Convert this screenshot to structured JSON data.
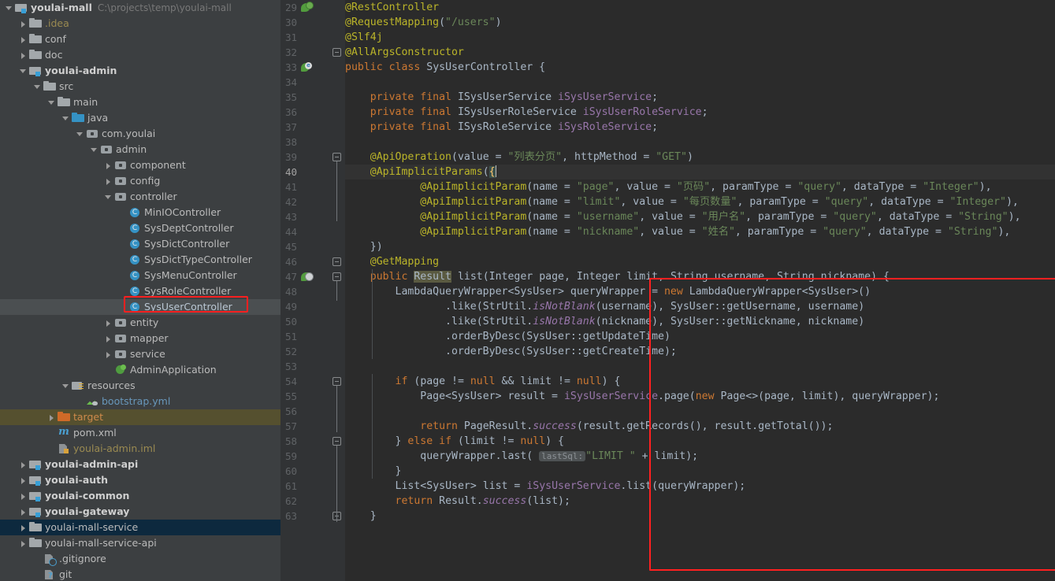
{
  "project": {
    "name": "youlai-mall",
    "path": "C:\\projects\\temp\\youlai-mall"
  },
  "colors": {
    "accent_highlight": "#ff2020",
    "selection_blue": "#0d293e",
    "target_folder": "#55502f",
    "editor_bg": "#2b2b2b",
    "gutter_bg": "#313335",
    "panel_bg": "#3c3f41"
  },
  "tree": {
    "items": [
      {
        "label": "youlai-mall",
        "suffix": "C:\\projects\\temp\\youlai-mall",
        "depth": 0,
        "arrow": "expanded",
        "icon": "module-folder-icon",
        "bold": true,
        "state": "none"
      },
      {
        "label": ".idea",
        "depth": 1,
        "arrow": "collapsed",
        "icon": "folder-icon",
        "bold": false,
        "state": "none",
        "tint": "yellow"
      },
      {
        "label": "conf",
        "depth": 1,
        "arrow": "collapsed",
        "icon": "folder-icon",
        "bold": false,
        "state": "none"
      },
      {
        "label": "doc",
        "depth": 1,
        "arrow": "collapsed",
        "icon": "folder-icon",
        "bold": false,
        "state": "none"
      },
      {
        "label": "youlai-admin",
        "depth": 1,
        "arrow": "expanded",
        "icon": "module-folder-icon",
        "bold": true,
        "state": "none"
      },
      {
        "label": "src",
        "depth": 2,
        "arrow": "expanded",
        "icon": "folder-icon",
        "bold": false,
        "state": "none"
      },
      {
        "label": "main",
        "depth": 3,
        "arrow": "expanded",
        "icon": "folder-icon",
        "bold": false,
        "state": "none"
      },
      {
        "label": "java",
        "depth": 4,
        "arrow": "expanded",
        "icon": "source-root-icon",
        "bold": false,
        "state": "none"
      },
      {
        "label": "com.youlai",
        "depth": 5,
        "arrow": "expanded",
        "icon": "package-icon",
        "bold": false,
        "state": "none"
      },
      {
        "label": "admin",
        "depth": 6,
        "arrow": "expanded",
        "icon": "package-icon",
        "bold": false,
        "state": "none"
      },
      {
        "label": "component",
        "depth": 7,
        "arrow": "collapsed",
        "icon": "package-icon",
        "bold": false,
        "state": "none"
      },
      {
        "label": "config",
        "depth": 7,
        "arrow": "collapsed",
        "icon": "package-icon",
        "bold": false,
        "state": "none"
      },
      {
        "label": "controller",
        "depth": 7,
        "arrow": "expanded",
        "icon": "package-icon",
        "bold": false,
        "state": "none"
      },
      {
        "label": "MinIOController",
        "depth": 8,
        "arrow": "none",
        "icon": "java-class-icon",
        "bold": false,
        "state": "none"
      },
      {
        "label": "SysDeptController",
        "depth": 8,
        "arrow": "none",
        "icon": "java-class-icon",
        "bold": false,
        "state": "none"
      },
      {
        "label": "SysDictController",
        "depth": 8,
        "arrow": "none",
        "icon": "java-class-icon",
        "bold": false,
        "state": "none"
      },
      {
        "label": "SysDictTypeController",
        "depth": 8,
        "arrow": "none",
        "icon": "java-class-icon",
        "bold": false,
        "state": "none"
      },
      {
        "label": "SysMenuController",
        "depth": 8,
        "arrow": "none",
        "icon": "java-class-icon",
        "bold": false,
        "state": "none"
      },
      {
        "label": "SysRoleController",
        "depth": 8,
        "arrow": "none",
        "icon": "java-class-icon",
        "bold": false,
        "state": "none"
      },
      {
        "label": "SysUserController",
        "depth": 8,
        "arrow": "none",
        "icon": "java-class-icon",
        "bold": false,
        "state": "hover"
      },
      {
        "label": "entity",
        "depth": 7,
        "arrow": "collapsed",
        "icon": "package-icon",
        "bold": false,
        "state": "none"
      },
      {
        "label": "mapper",
        "depth": 7,
        "arrow": "collapsed",
        "icon": "package-icon",
        "bold": false,
        "state": "none"
      },
      {
        "label": "service",
        "depth": 7,
        "arrow": "collapsed",
        "icon": "package-icon",
        "bold": false,
        "state": "none"
      },
      {
        "label": "AdminApplication",
        "depth": 7,
        "arrow": "none",
        "icon": "spring-boot-icon",
        "bold": false,
        "state": "none"
      },
      {
        "label": "resources",
        "depth": 4,
        "arrow": "expanded",
        "icon": "resources-folder-icon",
        "bold": false,
        "state": "none"
      },
      {
        "label": "bootstrap.yml",
        "depth": 5,
        "arrow": "none",
        "icon": "yaml-file-icon",
        "bold": false,
        "state": "none",
        "tint": "blue"
      },
      {
        "label": "target",
        "depth": 3,
        "arrow": "collapsed",
        "icon": "target-folder-icon",
        "bold": false,
        "state": "target",
        "tint": "orange"
      },
      {
        "label": "pom.xml",
        "depth": 3,
        "arrow": "none",
        "icon": "maven-file-icon",
        "bold": false,
        "state": "none"
      },
      {
        "label": "youlai-admin.iml",
        "depth": 3,
        "arrow": "none",
        "icon": "iml-file-icon",
        "bold": false,
        "state": "none",
        "tint": "yellow"
      },
      {
        "label": "youlai-admin-api",
        "depth": 1,
        "arrow": "collapsed",
        "icon": "module-folder-icon",
        "bold": true,
        "state": "none"
      },
      {
        "label": "youlai-auth",
        "depth": 1,
        "arrow": "collapsed",
        "icon": "module-folder-icon",
        "bold": true,
        "state": "none"
      },
      {
        "label": "youlai-common",
        "depth": 1,
        "arrow": "collapsed",
        "icon": "module-folder-icon",
        "bold": true,
        "state": "none"
      },
      {
        "label": "youlai-gateway",
        "depth": 1,
        "arrow": "collapsed",
        "icon": "module-folder-icon",
        "bold": true,
        "state": "none"
      },
      {
        "label": "youlai-mall-service",
        "depth": 1,
        "arrow": "collapsed",
        "icon": "folder-icon",
        "bold": false,
        "state": "selected"
      },
      {
        "label": "youlai-mall-service-api",
        "depth": 1,
        "arrow": "collapsed",
        "icon": "folder-icon",
        "bold": false,
        "state": "none"
      },
      {
        "label": ".gitignore",
        "depth": 2,
        "arrow": "none",
        "icon": "gitignore-file-icon",
        "bold": false,
        "state": "none"
      },
      {
        "label": "git",
        "depth": 2,
        "arrow": "none",
        "icon": "git-unknown-file-icon",
        "bold": false,
        "state": "none"
      }
    ]
  },
  "editor": {
    "file": "SysUserController.java",
    "first_line": 29,
    "caret_line": 40,
    "highlighted_identifier": "Result",
    "inlay_hint": "lastSql:",
    "lines": [
      {
        "n": 29,
        "gutter": "spring-bean-icon",
        "fold": null,
        "text": "@RestController"
      },
      {
        "n": 30,
        "gutter": null,
        "fold": null,
        "text": "@RequestMapping(\"/users\")"
      },
      {
        "n": 31,
        "gutter": null,
        "fold": null,
        "text": "@Slf4j"
      },
      {
        "n": 32,
        "gutter": null,
        "fold": "collapse",
        "text": "@AllArgsConstructor"
      },
      {
        "n": 33,
        "gutter": "spring-bean-e-icon",
        "fold": null,
        "text": "public class SysUserController {"
      },
      {
        "n": 34,
        "gutter": null,
        "fold": null,
        "text": ""
      },
      {
        "n": 35,
        "gutter": null,
        "fold": null,
        "text": "    private final ISysUserService iSysUserService;"
      },
      {
        "n": 36,
        "gutter": null,
        "fold": null,
        "text": "    private final ISysUserRoleService iSysUserRoleService;"
      },
      {
        "n": 37,
        "gutter": null,
        "fold": null,
        "text": "    private final ISysRoleService iSysRoleService;"
      },
      {
        "n": 38,
        "gutter": null,
        "fold": null,
        "text": ""
      },
      {
        "n": 39,
        "gutter": null,
        "fold": "collapse",
        "text": "    @ApiOperation(value = \"列表分页\", httpMethod = \"GET\")"
      },
      {
        "n": 40,
        "gutter": null,
        "fold": null,
        "text": "    @ApiImplicitParams({"
      },
      {
        "n": 41,
        "gutter": null,
        "fold": null,
        "text": "            @ApiImplicitParam(name = \"page\", value = \"页码\", paramType = \"query\", dataType = \"Integer\"),"
      },
      {
        "n": 42,
        "gutter": null,
        "fold": null,
        "text": "            @ApiImplicitParam(name = \"limit\", value = \"每页数量\", paramType = \"query\", dataType = \"Integer\"),"
      },
      {
        "n": 43,
        "gutter": null,
        "fold": null,
        "text": "            @ApiImplicitParam(name = \"username\", value = \"用户名\", paramType = \"query\", dataType = \"String\"),"
      },
      {
        "n": 44,
        "gutter": null,
        "fold": null,
        "text": "            @ApiImplicitParam(name = \"nickname\", value = \"姓名\", paramType = \"query\", dataType = \"String\"),"
      },
      {
        "n": 45,
        "gutter": null,
        "fold": null,
        "text": "    })"
      },
      {
        "n": 46,
        "gutter": null,
        "fold": "collapse",
        "text": "    @GetMapping"
      },
      {
        "n": 47,
        "gutter": "web-mapping-icon",
        "fold": "collapse",
        "text": "    public Result list(Integer page, Integer limit, String username, String nickname) {"
      },
      {
        "n": 48,
        "gutter": null,
        "fold": null,
        "text": "        LambdaQueryWrapper<SysUser> queryWrapper = new LambdaQueryWrapper<SysUser>()"
      },
      {
        "n": 49,
        "gutter": null,
        "fold": null,
        "text": "                .like(StrUtil.isNotBlank(username), SysUser::getUsername, username)"
      },
      {
        "n": 50,
        "gutter": null,
        "fold": null,
        "text": "                .like(StrUtil.isNotBlank(nickname), SysUser::getNickname, nickname)"
      },
      {
        "n": 51,
        "gutter": null,
        "fold": null,
        "text": "                .orderByDesc(SysUser::getUpdateTime)"
      },
      {
        "n": 52,
        "gutter": null,
        "fold": null,
        "text": "                .orderByDesc(SysUser::getCreateTime);"
      },
      {
        "n": 53,
        "gutter": null,
        "fold": null,
        "text": ""
      },
      {
        "n": 54,
        "gutter": null,
        "fold": "collapse",
        "text": "        if (page != null && limit != null) {"
      },
      {
        "n": 55,
        "gutter": null,
        "fold": null,
        "text": "            Page<SysUser> result = iSysUserService.page(new Page<>(page, limit), queryWrapper);"
      },
      {
        "n": 56,
        "gutter": null,
        "fold": null,
        "text": ""
      },
      {
        "n": 57,
        "gutter": null,
        "fold": null,
        "text": "            return PageResult.success(result.getRecords(), result.getTotal());"
      },
      {
        "n": 58,
        "gutter": null,
        "fold": "collapse",
        "text": "        } else if (limit != null) {"
      },
      {
        "n": 59,
        "gutter": null,
        "fold": null,
        "text": "            queryWrapper.last( lastSql: \"LIMIT \" + limit);"
      },
      {
        "n": 60,
        "gutter": null,
        "fold": null,
        "text": "        }"
      },
      {
        "n": 61,
        "gutter": null,
        "fold": null,
        "text": "        List<SysUser> list = iSysUserService.list(queryWrapper);"
      },
      {
        "n": 62,
        "gutter": null,
        "fold": null,
        "text": "        return Result.success(list);"
      },
      {
        "n": 63,
        "gutter": null,
        "fold": "collapse",
        "text": "    }"
      }
    ]
  },
  "annotations": {
    "tree_highlight_target": "SysUserController",
    "code_highlight_range": "lines 46-63"
  }
}
